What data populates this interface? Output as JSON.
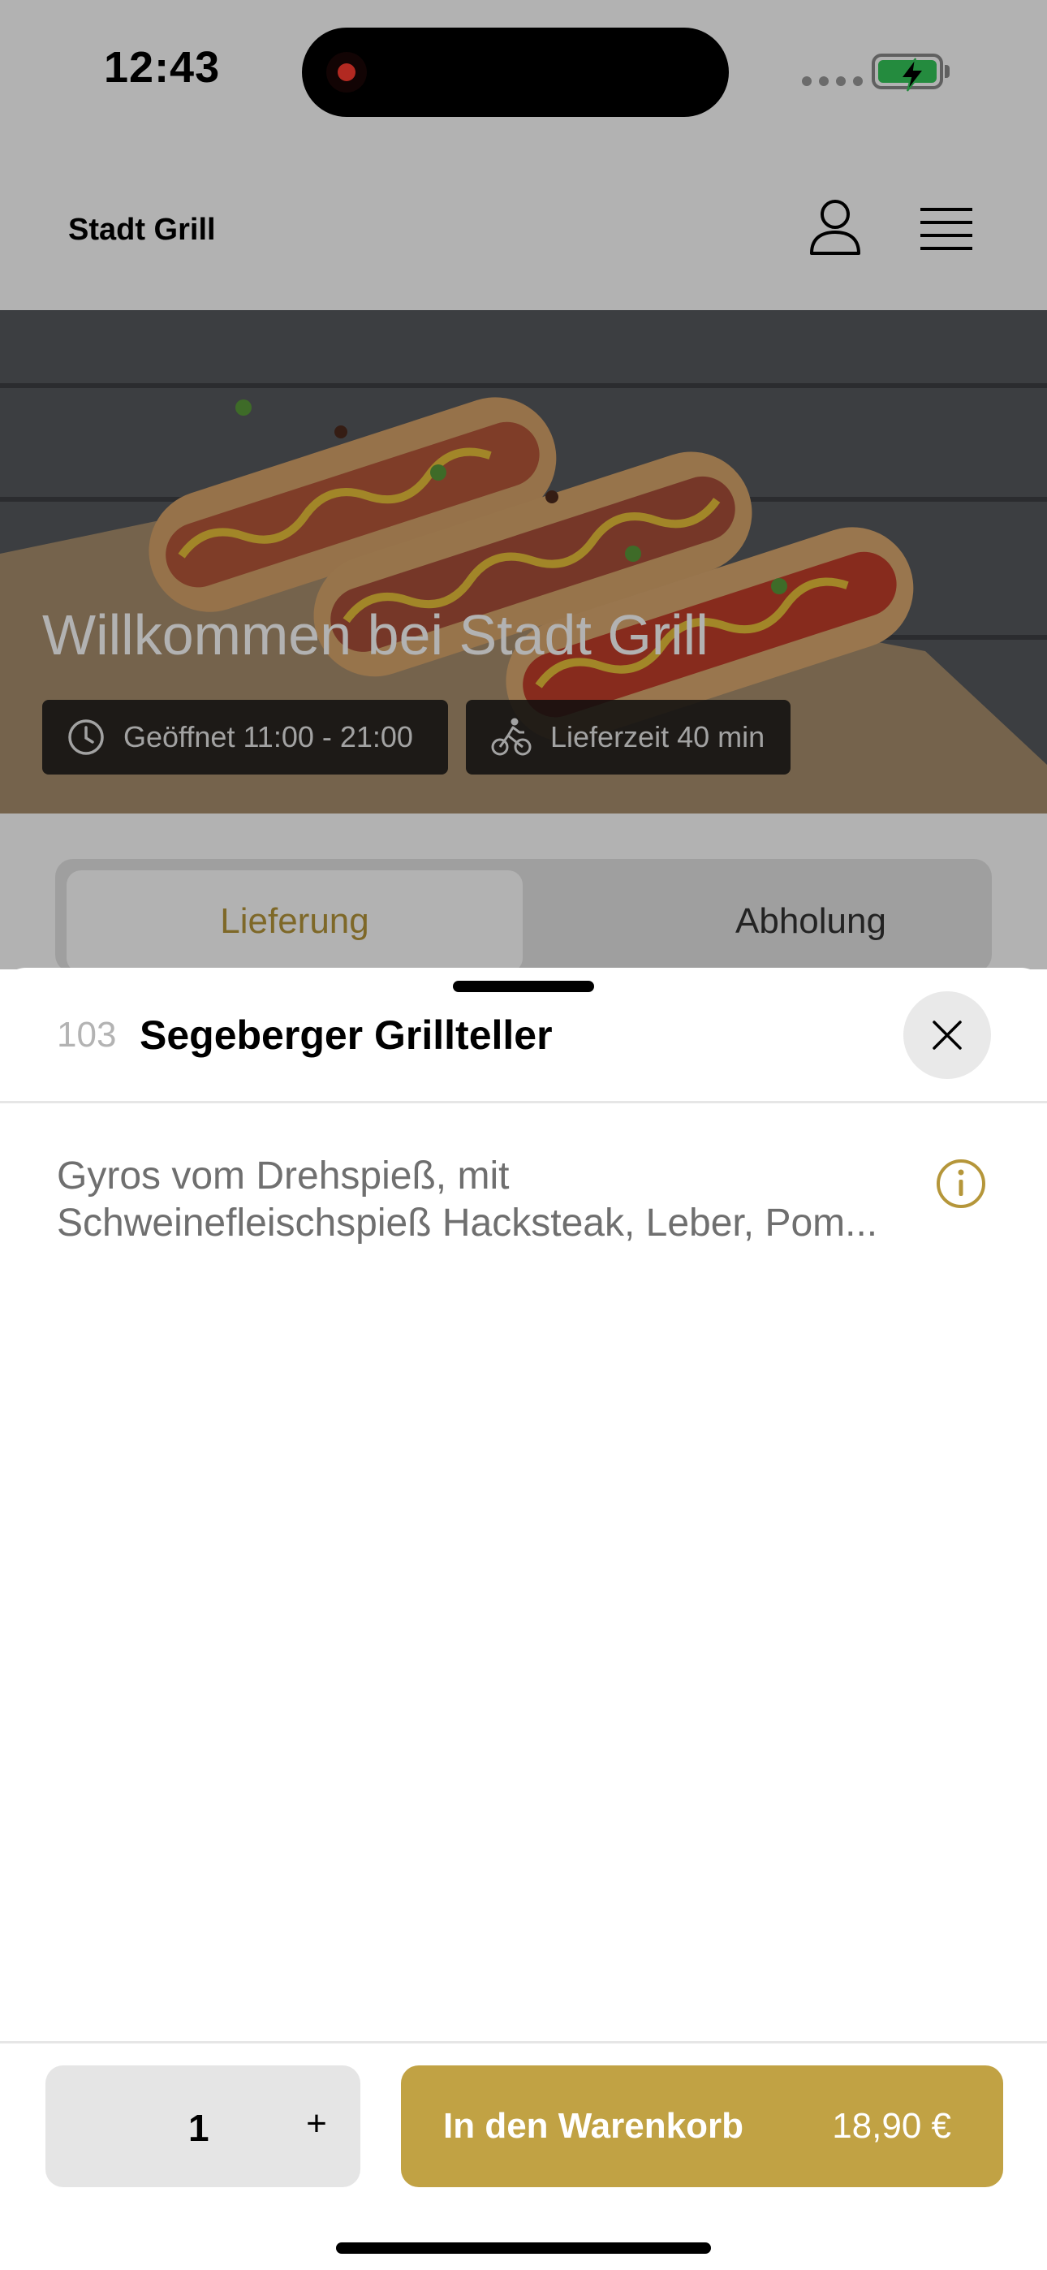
{
  "status_bar": {
    "time": "12:43",
    "recording_indicator_color": "#ff3b30",
    "battery_color": "#34c759",
    "battery_state": "charging"
  },
  "header": {
    "brand": "Stadt Grill",
    "user_icon": "person-icon",
    "menu_icon": "hamburger-icon"
  },
  "hero": {
    "title": "Willkommen bei Stadt Grill",
    "image_subject": "hot-dogs",
    "opening_hours": "Geöffnet 11:00 - 21:00",
    "delivery_time": "Lieferzeit 40 min"
  },
  "mode_toggle": {
    "tabs": [
      {
        "label": "Lieferung",
        "active": true
      },
      {
        "label": "Abholung",
        "active": false
      }
    ]
  },
  "sheet": {
    "item_number": "103",
    "item_name": "Segeberger Grillteller",
    "description_lines": [
      "Gyros vom Drehspieß, mit",
      "Schweinefleischspieß Hacksteak, Leber, Pom..."
    ],
    "close_icon": "close-icon",
    "info_icon": "info-icon"
  },
  "footer": {
    "quantity": "1",
    "plus": "+",
    "add_to_cart": "In den Warenkorb",
    "price": "18,90 €"
  },
  "colors": {
    "accent": "#c1a244",
    "accent_text": "#b5963a"
  }
}
